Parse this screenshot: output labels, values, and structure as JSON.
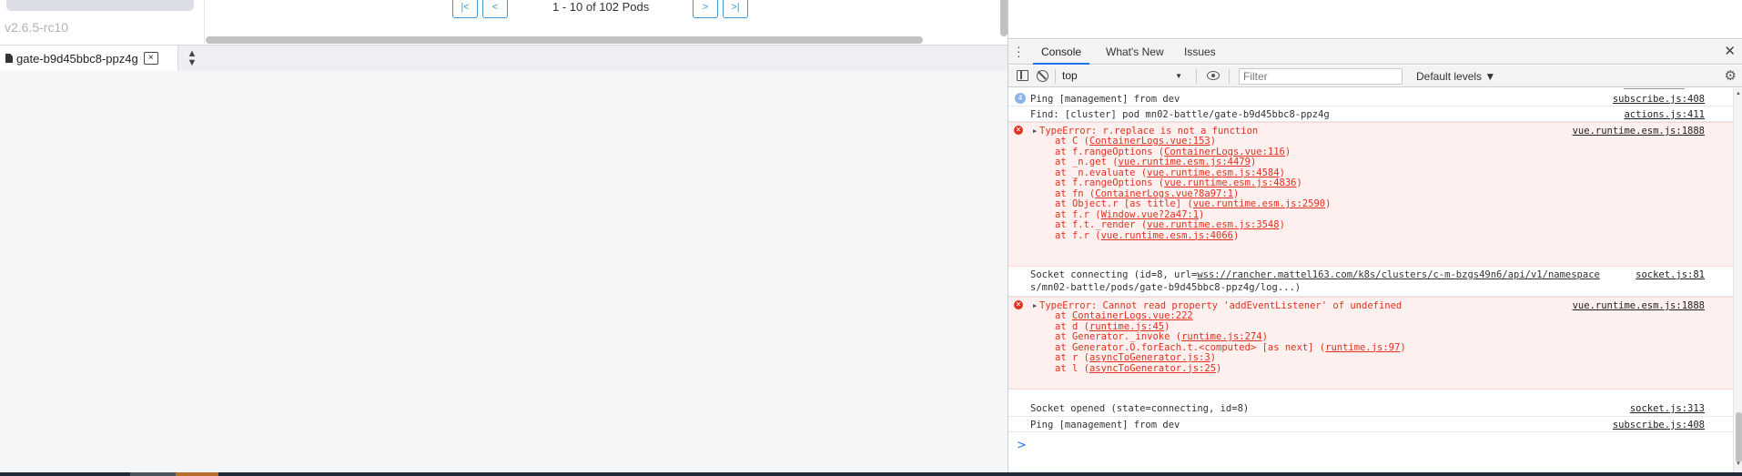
{
  "app": {
    "version": "v2.6.5-rc10",
    "pagination": {
      "first_label": "|<",
      "prev_label": "<",
      "text": "1 - 10 of 102 Pods",
      "next_label": ">",
      "last_label": ">|"
    },
    "shell_tab": {
      "label": "gate-b9d45bbc8-ppz4g",
      "close_label": "×"
    }
  },
  "devtools": {
    "tabs": [
      "Console",
      "What's New",
      "Issues"
    ],
    "active_tab": "Console",
    "toolbar": {
      "context": "top",
      "filter_placeholder": "Filter",
      "levels": "Default levels ▼"
    },
    "messages": [
      {
        "type": "info",
        "text": "Ping [management] from dev",
        "source": "subscribe.js:408"
      },
      {
        "type": "log",
        "text": "Find: [cluster] pod mn02-battle/gate-b9d45bbc8-ppz4g",
        "source": "actions.js:411"
      },
      {
        "type": "error",
        "text": "TypeError: r.replace is not a function",
        "source": "vue.runtime.esm.js:1888",
        "stack": [
          {
            "fn": "at C (",
            "ref": "ContainerLogs.vue:153",
            "end": ")"
          },
          {
            "fn": "at f.rangeOptions (",
            "ref": "ContainerLogs.vue:116",
            "end": ")"
          },
          {
            "fn": "at _n.get (",
            "ref": "vue.runtime.esm.js:4479",
            "end": ")"
          },
          {
            "fn": "at _n.evaluate (",
            "ref": "vue.runtime.esm.js:4584",
            "end": ")"
          },
          {
            "fn": "at f.rangeOptions (",
            "ref": "vue.runtime.esm.js:4836",
            "end": ")"
          },
          {
            "fn": "at fn (",
            "ref": "ContainerLogs.vue?8a97:1",
            "end": ")"
          },
          {
            "fn": "at Object.r [as title] (",
            "ref": "vue.runtime.esm.js:2590",
            "end": ")"
          },
          {
            "fn": "at f.r (",
            "ref": "Window.vue?2a47:1",
            "end": ")"
          },
          {
            "fn": "at f.t._render (",
            "ref": "vue.runtime.esm.js:3548",
            "end": ")"
          },
          {
            "fn": "at f.r (",
            "ref": "vue.runtime.esm.js:4066",
            "end": ")"
          }
        ]
      },
      {
        "type": "log",
        "text": "Socket connecting (id=8, url=",
        "link": "wss://rancher.mattel163.com/k8s/clusters/c-m-bzgs49n6/api/v1/namespace",
        "text2": "s/mn02-battle/pods/gate-b9d45bbc8-ppz4g/log...)",
        "source": "socket.js:81"
      },
      {
        "type": "error",
        "text": "TypeError: Cannot read property 'addEventListener' of undefined",
        "source": "vue.runtime.esm.js:1888",
        "stack": [
          {
            "fn": "at ",
            "ref": "ContainerLogs.vue:222",
            "end": ""
          },
          {
            "fn": "at d (",
            "ref": "runtime.js:45",
            "end": ")"
          },
          {
            "fn": "at Generator._invoke (",
            "ref": "runtime.js:274",
            "end": ")"
          },
          {
            "fn": "at Generator.O.forEach.t.<computed> [as next] (",
            "ref": "runtime.js:97",
            "end": ")"
          },
          {
            "fn": "at r (",
            "ref": "asyncToGenerator.js:3",
            "end": ")"
          },
          {
            "fn": "at l (",
            "ref": "asyncToGenerator.js:25",
            "end": ")"
          }
        ]
      },
      {
        "type": "log",
        "text": "Socket opened (state=connecting, id=8)",
        "source": "socket.js:313"
      },
      {
        "type": "log",
        "text": "Ping [management] from dev",
        "source": "subscribe.js:408"
      }
    ],
    "info_badge": "4",
    "prompt": ">"
  }
}
